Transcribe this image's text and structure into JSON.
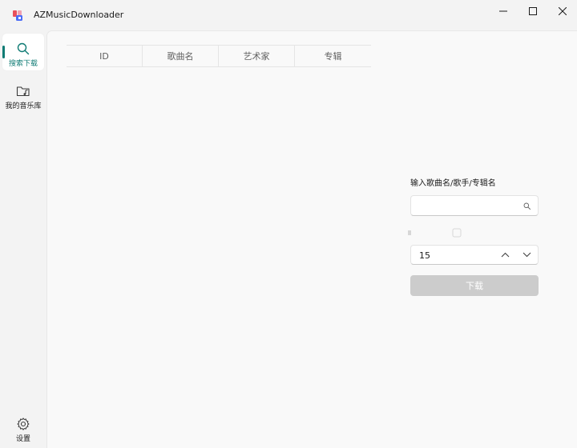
{
  "window": {
    "title": "AZMusicDownloader"
  },
  "nav": {
    "items": [
      {
        "id": "search",
        "label": "搜索下载",
        "icon": "search-icon",
        "active": true
      },
      {
        "id": "library",
        "label": "我的音乐库",
        "icon": "music-folder-icon",
        "active": false
      }
    ],
    "settings": {
      "label": "设置",
      "icon": "gear-icon"
    }
  },
  "table": {
    "columns": [
      "ID",
      "歌曲名",
      "艺术家",
      "专辑"
    ],
    "rows": []
  },
  "search_panel": {
    "prompt": "输入歌曲名/歌手/专辑名",
    "query": "",
    "count": "15",
    "download_label": "下载"
  },
  "colors": {
    "accent": "#0f7b74",
    "disabled_button": "#cccccc"
  }
}
